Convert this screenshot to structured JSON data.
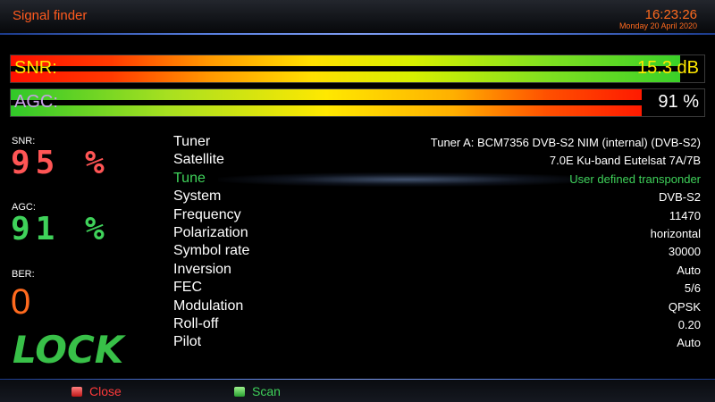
{
  "header": {
    "title": "Signal finder",
    "time": "16:23:26",
    "date": "Monday 20 April 2020"
  },
  "bars": {
    "snr": {
      "label": "SNR:",
      "value": "15.3 dB",
      "fill_percent": 96.5
    },
    "agc": {
      "label": "AGC:",
      "value": "91 %",
      "fill_percent": 91
    }
  },
  "readouts": {
    "snr": {
      "label": "SNR:",
      "value": "95 %"
    },
    "agc": {
      "label": "AGC:",
      "value": "91 %"
    },
    "ber": {
      "label": "BER:",
      "value": "0"
    },
    "lock": "LOCK"
  },
  "info": [
    {
      "key": "Tuner",
      "value": "Tuner A: BCM7356 DVB-S2 NIM (internal) (DVB-S2)"
    },
    {
      "key": "Satellite",
      "value": "7.0E Ku-band Eutelsat 7A/7B"
    },
    {
      "key": "Tune",
      "value": "User defined transponder"
    },
    {
      "key": "System",
      "value": "DVB-S2"
    },
    {
      "key": "Frequency",
      "value": "11470"
    },
    {
      "key": "Polarization",
      "value": "horizontal"
    },
    {
      "key": "Symbol rate",
      "value": "30000"
    },
    {
      "key": "Inversion",
      "value": "Auto"
    },
    {
      "key": "FEC",
      "value": "5/6"
    },
    {
      "key": "Modulation",
      "value": "QPSK"
    },
    {
      "key": "Roll-off",
      "value": "0.20"
    },
    {
      "key": "Pilot",
      "value": "Auto"
    }
  ],
  "footer": {
    "close": {
      "label": "Close",
      "color": "#ff3a3a"
    },
    "scan": {
      "label": "Scan",
      "color": "#3fd25a"
    }
  },
  "colors": {
    "accent_orange": "#ff5a1e",
    "highlight_green": "#3fd25a",
    "red_readout": "#ff5555"
  }
}
